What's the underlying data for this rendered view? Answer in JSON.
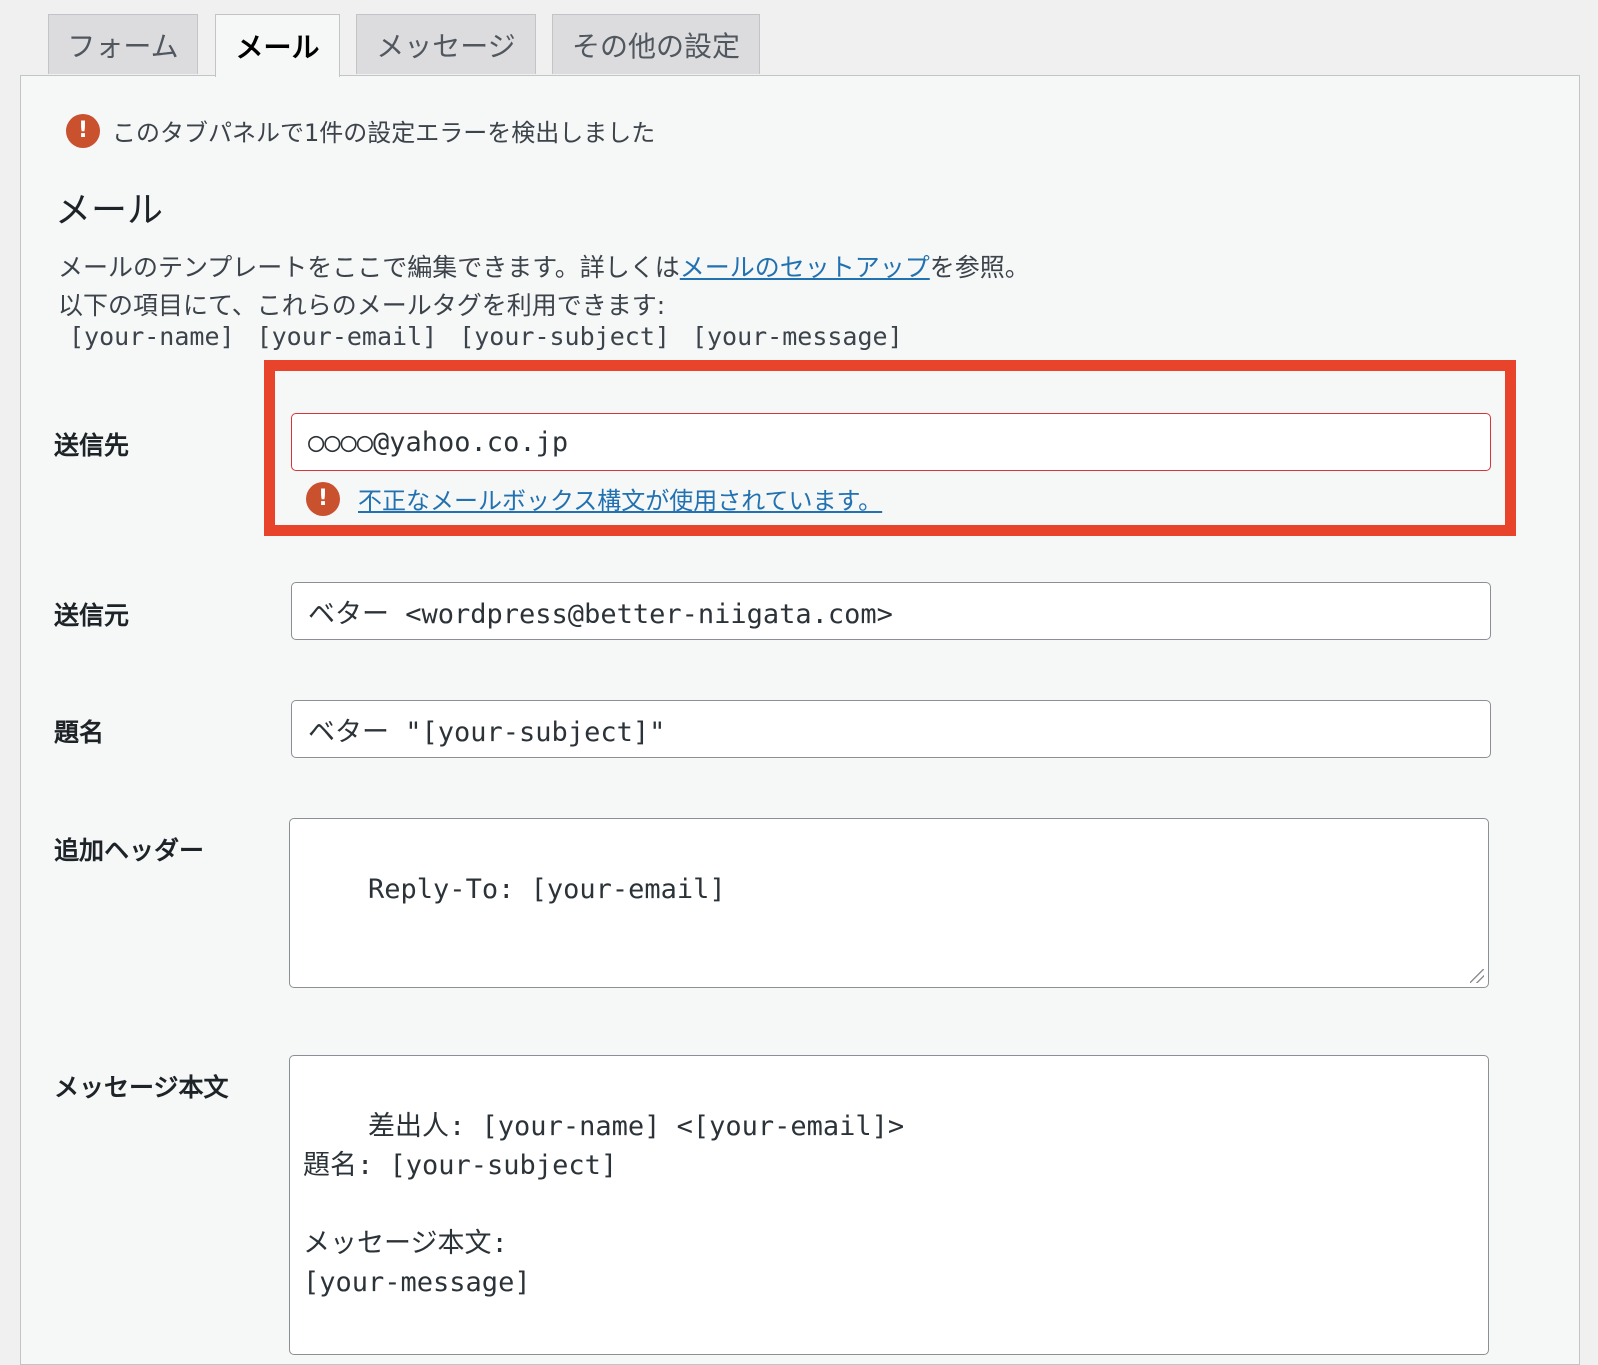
{
  "tabs": [
    {
      "label": "フォーム"
    },
    {
      "label": "メール"
    },
    {
      "label": "メッセージ"
    },
    {
      "label": "その他の設定"
    }
  ],
  "panel": {
    "notice_text": "このタブパネルで1件の設定エラーを検出しました",
    "title": "メール",
    "desc_prefix": "メールのテンプレートをここで編集できます。詳しくは",
    "desc_link": "メールのセットアップ",
    "desc_suffix": "を参照。",
    "desc_line2": "以下の項目にて、これらのメールタグを利用できます:",
    "tags": [
      "[your-name]",
      "[your-email]",
      "[your-subject]",
      "[your-message]"
    ]
  },
  "fields": {
    "to": {
      "label": "送信先",
      "value": "○○○○@yahoo.co.jp",
      "error": "不正なメールボックス構文が使用されています。"
    },
    "from": {
      "label": "送信元",
      "value": "ベター <wordpress@better-niigata.com>"
    },
    "subject": {
      "label": "題名",
      "value": "ベター \"[your-subject]\""
    },
    "headers": {
      "label": "追加ヘッダー",
      "value": "Reply-To: [your-email]"
    },
    "body": {
      "label": "メッセージ本文",
      "value": "差出人: [your-name] <[your-email]>\n題名: [your-subject]\n\nメッセージ本文:\n[your-message]"
    }
  },
  "colors": {
    "error": "#c9512e",
    "highlight": "#e8432b",
    "link": "#2271b1"
  }
}
